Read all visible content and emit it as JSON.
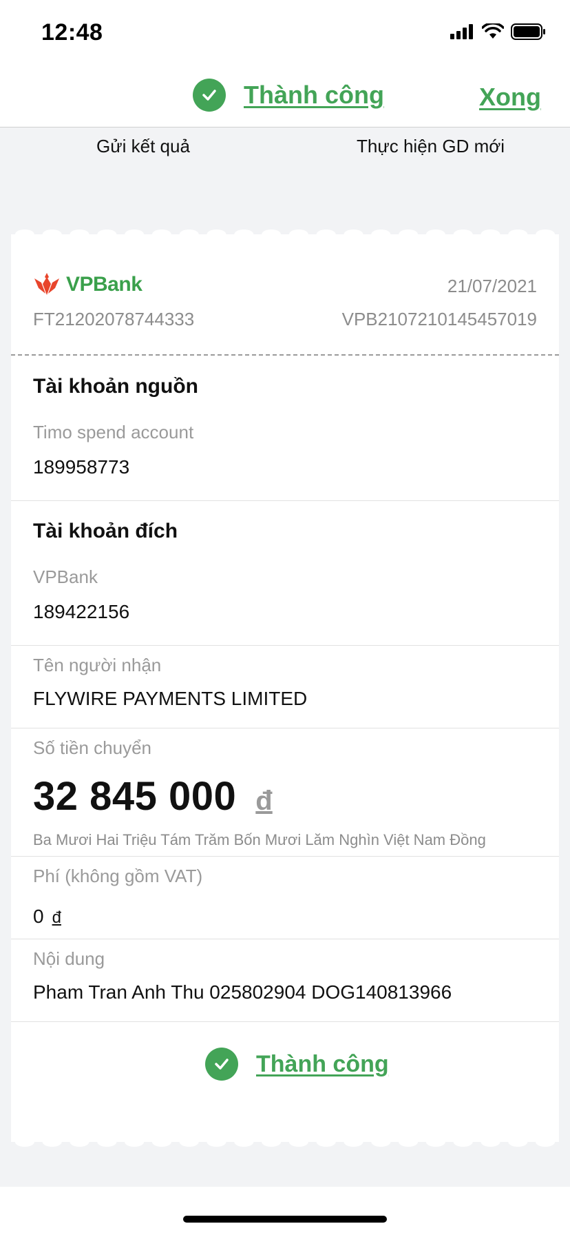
{
  "status_bar": {
    "time": "12:48"
  },
  "header": {
    "title": "Thành công",
    "done_label": "Xong"
  },
  "actions": {
    "send_result": "Gửi kết quả",
    "new_transaction": "Thực hiện GD mới"
  },
  "receipt": {
    "bank_logo_text": "VPBank",
    "date": "21/07/2021",
    "ref_left": "FT21202078744333",
    "ref_right": "VPB2107210145457019",
    "source": {
      "title": "Tài khoản nguồn",
      "label": "Timo spend account",
      "value": "189958773"
    },
    "destination": {
      "title": "Tài khoản đích",
      "label": "VPBank",
      "value": "189422156"
    },
    "recipient": {
      "label": "Tên người nhận",
      "value": "FLYWIRE PAYMENTS LIMITED"
    },
    "amount": {
      "label": "Số tiền chuyển",
      "value": "32 845 000",
      "currency": "đ",
      "in_words": "Ba Mươi Hai Triệu Tám Trăm Bốn Mươi Lăm Nghìn Việt Nam Đồng"
    },
    "fee": {
      "label": "Phí (không gồm VAT)",
      "value": "0",
      "currency": "đ"
    },
    "content": {
      "label": "Nội dung",
      "value": "Pham Tran Anh Thu 025802904 DOG140813966"
    },
    "status": "Thành công"
  },
  "colors": {
    "accent_green": "#43a457",
    "logo_red": "#e8452c",
    "muted_text": "#9a9a9a"
  }
}
